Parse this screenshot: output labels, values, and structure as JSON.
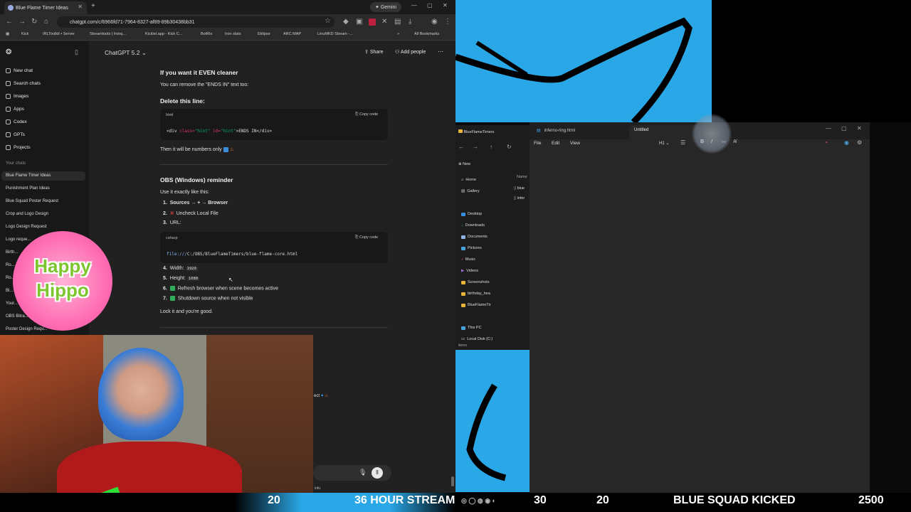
{
  "browser": {
    "tab_title": "Blue Flame Timer Ideas",
    "gemini": "Gemini",
    "url": "chatgpt.com/c/6966fd71-7964-8327-af89-89b30438bb31",
    "bookmarks": [
      "Kick",
      "IRLToolkit • Server",
      "Streamloots | Ironq...",
      "Kicklet.app - Kick C...",
      "BotRix",
      "Iron stats",
      "Eklipse",
      "ARC MAP",
      "LinuMKD Stream -..."
    ],
    "all_bookmarks": "All Bookmarks"
  },
  "sidebar": {
    "items": [
      "New chat",
      "Search chats",
      "Images",
      "Apps",
      "Codex",
      "GPTs",
      "Projects"
    ],
    "your_chats": "Your chats",
    "chats": [
      "Blue Flame Timer Ideas",
      "Punishment Plan Ideas",
      "Blue Squad Poster Request",
      "Crop and Logo Design",
      "Logo Design Request",
      "Logo reque...",
      "Birth...",
      "Ro...",
      "Ro...",
      "Bl...",
      "Your...",
      "OBS Bitra...",
      "Poster Design Requ..."
    ]
  },
  "chat": {
    "model": "ChatGPT 5.2",
    "share": "Share",
    "add_people": "Add people",
    "h_cleaner": "If you want it EVEN cleaner",
    "p_remove": "You can remove the \"ENDS IN\" text too:",
    "h_delete": "Delete this line:",
    "code1_lang": "html",
    "copy_code": "Copy code",
    "code1_a": "<div ",
    "code1_b": "class=",
    "code1_c": "\"hint\"",
    "code1_d": " id=",
    "code1_e": "\"hint\"",
    "code1_f": ">ENDS IN</div>",
    "p_numbers": "Then it will be numbers only",
    "h_obs": "OBS (Windows) reminder",
    "p_use": "Use it exactly like this:",
    "s1_num": "1.",
    "s1": "Sources → + → Browser",
    "s2_num": "2.",
    "s2": "Uncheck Local File",
    "s3_num": "3.",
    "s3": "URL:",
    "code2_lang": "csharp",
    "code2_a": "file:///",
    "code2_b": "C:/OBS/BlueFlameTimers/blue-flame-core.html",
    "s4_num": "4.",
    "s4": "Width:",
    "s4v": "1920",
    "s5_num": "5.",
    "s5": "Height:",
    "s5v": "1080",
    "s6_num": "6.",
    "s6": "Refresh browser when scene becomes active",
    "s7_num": "7.",
    "s7": "Shutdown source when not visible",
    "p_lock": "Lock it and you're good.",
    "partial_msg": "ect",
    "info": "info."
  },
  "overlay": {
    "hippo_line1": "Happy",
    "hippo_line2": "Hippo"
  },
  "explorer": {
    "title": "BlueFlameTimers",
    "new": "New",
    "nav": [
      "Home",
      "Gallery"
    ],
    "quick": [
      "Desktop",
      "Downloads",
      "Documents",
      "Pictures",
      "Music",
      "Videos",
      "Screenshots",
      "birthday_hea",
      "BlueFlameTir"
    ],
    "this_pc": "This PC",
    "local_disk": "Local Disk (C:)",
    "items": "items",
    "col_name": "Name",
    "files": [
      "blue",
      "infer"
    ]
  },
  "editor": {
    "tab1": "inferno-ring.html",
    "tab2": "Untitled",
    "menu": [
      "File",
      "Edit",
      "View"
    ],
    "heading": "H1"
  },
  "stats": {
    "a": "20",
    "b": "36 HOUR STREAM",
    "c": "30",
    "d": "20",
    "e": "BLUE SQUAD KICKED",
    "f": "2500"
  },
  "colors": {
    "accent_blue": "#2aa7e6",
    "check_green": "#2fae5a",
    "x_red": "#e0403c"
  }
}
